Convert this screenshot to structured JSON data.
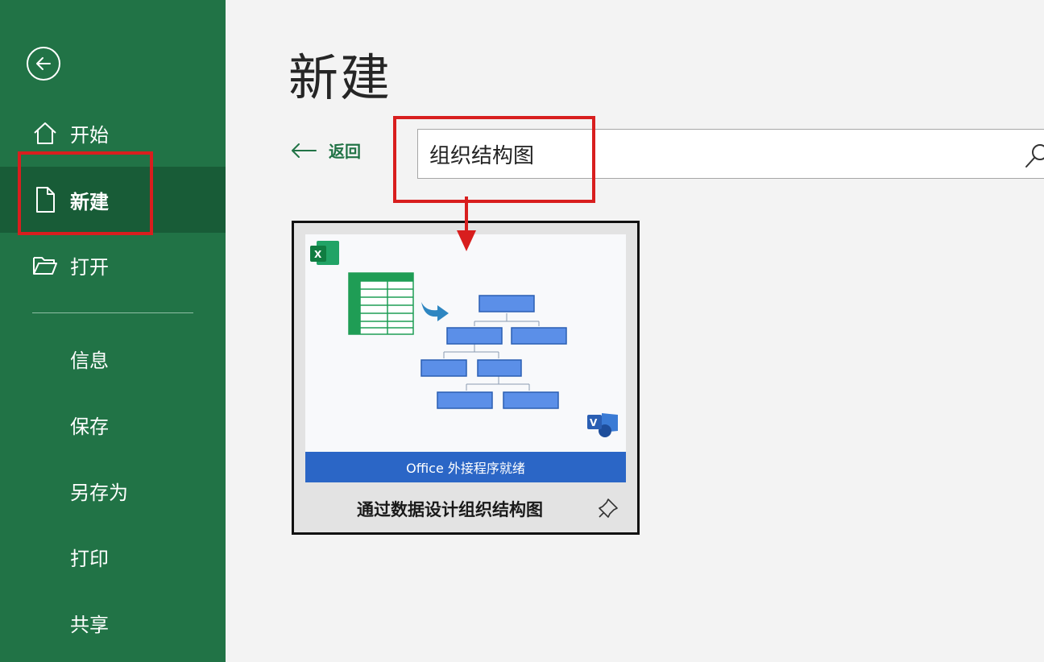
{
  "sidebar": {
    "back_icon": "back-arrow-circle-icon",
    "items": [
      {
        "label": "开始",
        "icon": "home-icon"
      },
      {
        "label": "新建",
        "icon": "new-document-icon",
        "active": true
      },
      {
        "label": "打开",
        "icon": "folder-open-icon"
      }
    ],
    "sub_items": [
      "信息",
      "保存",
      "另存为",
      "打印",
      "共享"
    ]
  },
  "main": {
    "title": "新建",
    "back_link": "返回",
    "search": {
      "value": "组织结构图",
      "icon": "search-icon"
    },
    "template": {
      "banner": "Office 外接程序就绪",
      "title": "通过数据设计组织结构图",
      "pin_icon": "pin-icon"
    }
  },
  "colors": {
    "sidebar": "#217346",
    "sidebar_active": "#185c37",
    "accent": "#217346",
    "annotation": "#d81e1e",
    "banner": "#2b66c6"
  }
}
